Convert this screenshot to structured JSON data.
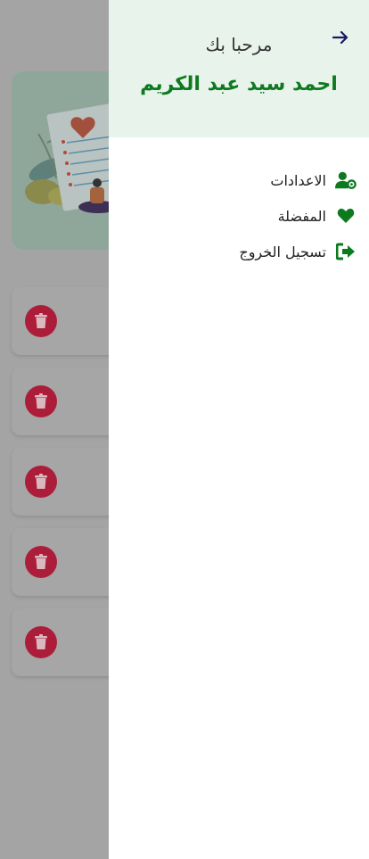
{
  "drawer": {
    "welcome": "مرحبا بك",
    "user_name": "احمد سيد عبد الكريم",
    "back_icon": "arrow-right-icon",
    "items": [
      {
        "label": "الاعدادات",
        "icon": "user-gear-icon"
      },
      {
        "label": "المفضلة",
        "icon": "heart-icon"
      },
      {
        "label": "تسجيل الخروج",
        "icon": "sign-out-icon"
      }
    ]
  },
  "background": {
    "cards_count": 5,
    "delete_icon": "trash-icon"
  },
  "colors": {
    "accent_green": "#0e7a1f",
    "header_bg": "#e8f3ec",
    "delete_red": "#ac1d3a",
    "scrim": "#a4a4a4"
  }
}
